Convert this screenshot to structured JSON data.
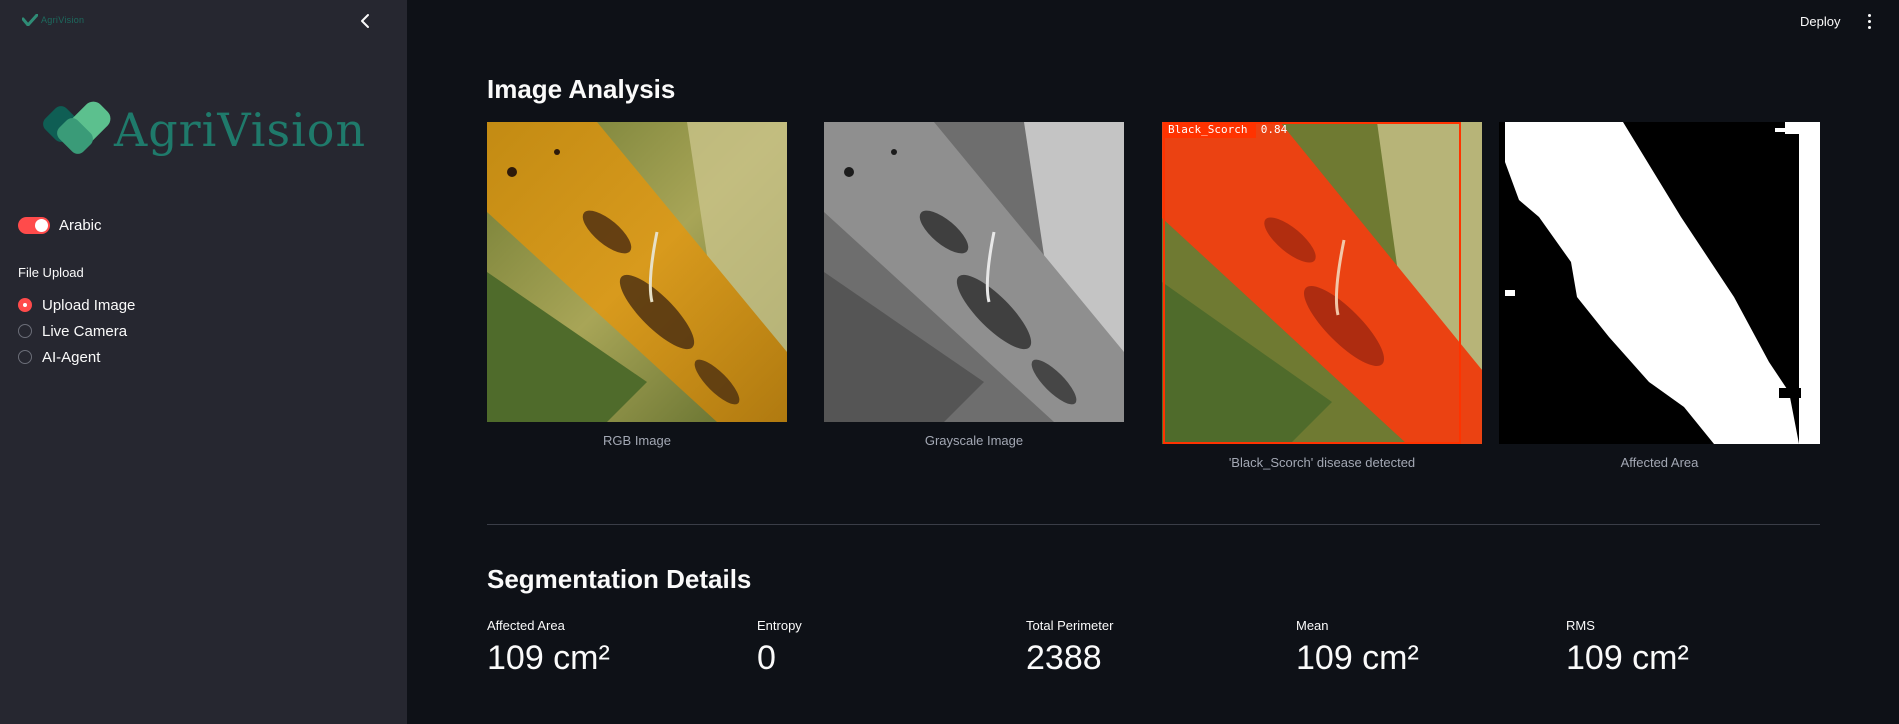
{
  "sidebar": {
    "mini_logo_text": "AgriVision",
    "brand_name": "AgriVision",
    "collapse_icon": "chevron-left-icon",
    "toggle": {
      "label": "Arabic",
      "on": true
    },
    "file_upload": {
      "title": "File Upload",
      "options": [
        {
          "label": "Upload Image",
          "selected": true
        },
        {
          "label": "Live Camera",
          "selected": false
        },
        {
          "label": "AI-Agent",
          "selected": false
        }
      ]
    }
  },
  "header": {
    "deploy_label": "Deploy",
    "menu_icon": "more-vertical-icon"
  },
  "main": {
    "image_analysis_title": "Image Analysis",
    "images": [
      {
        "caption": "RGB Image"
      },
      {
        "caption": "Grayscale Image"
      },
      {
        "caption": "'Black_Scorch' disease detected",
        "detection_label": "Black_Scorch  0.84"
      },
      {
        "caption": "Affected Area"
      }
    ],
    "segmentation_title": "Segmentation Details",
    "metrics": [
      {
        "label": "Affected Area",
        "value": "109 cm²"
      },
      {
        "label": "Entropy",
        "value": "0"
      },
      {
        "label": "Total Perimeter",
        "value": "2388"
      },
      {
        "label": "Mean",
        "value": "109 cm²"
      },
      {
        "label": "RMS",
        "value": "109 cm²"
      }
    ]
  },
  "colors": {
    "app_bg": "#0e1117",
    "sidebar_bg": "#262730",
    "accent": "#ff4b4b",
    "brand_green": "#1f7a6b"
  }
}
